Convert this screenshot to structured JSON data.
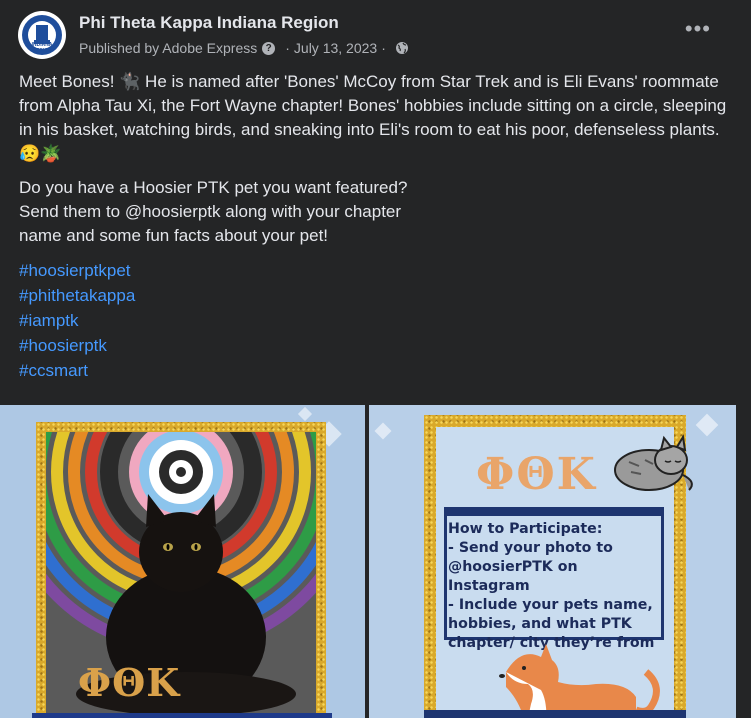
{
  "header": {
    "page_name": "Phi Theta Kappa Indiana Region",
    "published_by": "Published by Adobe Express",
    "date": "July 13, 2023",
    "avatar_text": "INDIANA REGION"
  },
  "post": {
    "paragraph1": "Meet Bones! 🐈‍⬛ He is named after 'Bones' McCoy from Star Trek and is Eli Evans' roommate from Alpha Tau Xi, the Fort Wayne chapter! Bones' hobbies include sitting on a circle, sleeping in his basket, watching birds, and sneaking into Eli's room to eat his poor, defenseless plants. 😥🪴",
    "paragraph2": "Do you have a Hoosier PTK pet you want featured?\nSend them to @hoosierptk along with your chapter\nname and some fun facts about your pet!",
    "hashtags": [
      "#hoosierptkpet",
      "#phithetakappa",
      "#iamptk",
      "#hoosierptk",
      "#ccsmart"
    ]
  },
  "images": {
    "left": {
      "logo_text": "ΦΘΚ"
    },
    "right": {
      "logo_text": "ΦΘΚ",
      "how_to": "How to Participate:\n- Send your photo to\n@hoosierPTK on Instagram\n- Include your pets name,\nhobbies, and what PTK\nchapter/ city they’re from"
    }
  },
  "icons": {
    "more": "more-options-icon",
    "info": "info-icon",
    "audience": "globe-icon"
  },
  "colors": {
    "background": "#242526",
    "text": "#e4e6eb",
    "secondary_text": "#b0b3b8",
    "link": "#4599ff",
    "gold_frame": "#d9a92b",
    "navy": "#1e3570"
  }
}
